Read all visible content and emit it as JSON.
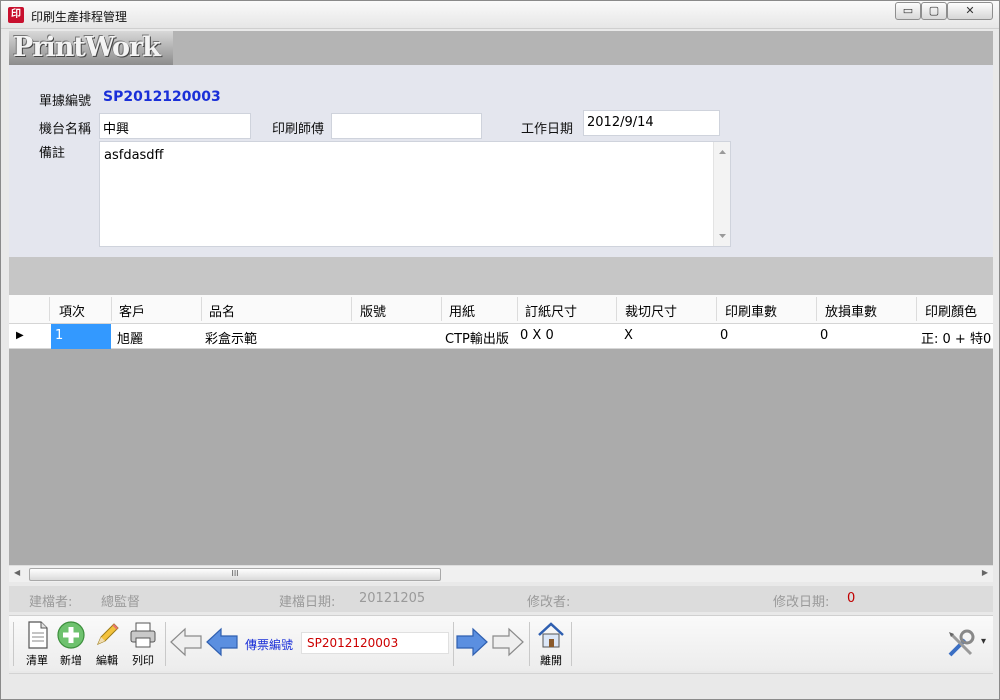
{
  "window": {
    "title": "印刷生產排程管理",
    "icon": "app-logo-icon",
    "controls": {
      "minimize": "▭",
      "maximize": "▢",
      "close": "✕"
    }
  },
  "banner": {
    "logo_text": "PrintWork"
  },
  "form": {
    "doc_no_label": "單據編號",
    "doc_no_value": "SP2012120003",
    "machine_label": "機台名稱",
    "machine_value": "中興",
    "printer_label": "印刷師傅",
    "printer_value": "",
    "workdate_label": "工作日期",
    "workdate_value": "2012/9/14",
    "notes_label": "備註",
    "notes_value": "asfdasdff"
  },
  "grid": {
    "headers": [
      "項次",
      "客戶",
      "品名",
      "版號",
      "用紙",
      "訂紙尺寸",
      "裁切尺寸",
      "印刷車數",
      "放損車數",
      "印刷顏色"
    ],
    "rows": [
      {
        "indicator": "▶",
        "item": "1",
        "customer": "旭麗",
        "product": "彩盒示範",
        "plate": "",
        "paper": "CTP輸出版",
        "order_size": "0 X 0",
        "cut_size": "X",
        "print_runs": "0",
        "waste_runs": "0",
        "colors": "正: 0 + 特0"
      }
    ],
    "scroll_left": "◀",
    "scroll_right": "▶",
    "thumb_grip": "III"
  },
  "info": {
    "creator_label": "建檔者:",
    "creator_value": "總監督",
    "created_label": "建檔日期:",
    "created_value": "20121205",
    "modifier_label": "修改者:",
    "modifier_value": "",
    "modified_label": "修改日期:",
    "modified_value": "0"
  },
  "toolbar": {
    "clear_label": "清單",
    "add_label": "新增",
    "edit_label": "編輯",
    "print_label": "列印",
    "ticket_label": "傳票編號",
    "ticket_value": "SP2012120003",
    "exit_label": "離開",
    "tools_icon": "tools-icon",
    "dropdown": "▾"
  },
  "colors": {
    "accent_blue": "#1a2fd8",
    "selection": "#3399ff",
    "red_value": "#c00000"
  }
}
